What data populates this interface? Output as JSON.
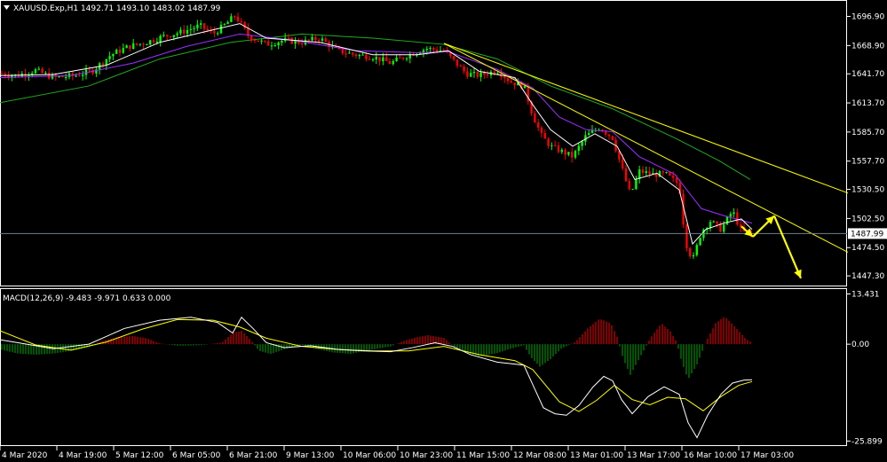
{
  "window": {
    "title": "XAUUSD.Exp,H1  1492.71 1493.10 1483.02 1487.99",
    "menu_icon": "triangle-down-icon"
  },
  "colors": {
    "background": "#000000",
    "axis": "#ffffff",
    "bull": "#00ff00",
    "bear": "#ff0000",
    "ma_fast": "#ffffff",
    "ma_purple": "#9b30ff",
    "ma_green": "#22aa22",
    "trendline": "#ffff00",
    "arrow": "#ffff00",
    "bid_line": "#708090",
    "macd_pos": "#ff0000",
    "macd_neg": "#00aa00",
    "macd_main": "#ffffff",
    "macd_signal": "#ffff00"
  },
  "chart_data": [
    {
      "type": "candlestick",
      "symbol": "XAUUSD.Exp",
      "timeframe": "H1",
      "ohlc_header": {
        "open": 1492.71,
        "high": 1493.1,
        "low": 1483.02,
        "close": 1487.99
      },
      "current_price_label": "1487.99",
      "ylim": [
        1438,
        1711
      ],
      "y_ticks": [
        "1696.90",
        "1668.90",
        "1641.70",
        "1613.70",
        "1585.70",
        "1557.70",
        "1530.50",
        "1502.50",
        "1474.50",
        "1447.30"
      ],
      "y_tick_values": [
        1696.9,
        1668.9,
        1641.7,
        1613.7,
        1585.7,
        1557.7,
        1530.5,
        1502.5,
        1474.5,
        1447.3
      ],
      "x_ticks": [
        "4 Mar 2020",
        "4 Mar 19:00",
        "5 Mar 12:00",
        "6 Mar 05:00",
        "6 Mar 21:00",
        "9 Mar 13:00",
        "10 Mar 06:00",
        "10 Mar 23:00",
        "11 Mar 15:00",
        "12 Mar 08:00",
        "13 Mar 01:00",
        "13 Mar 17:00",
        "16 Mar 10:00",
        "17 Mar 03:00"
      ],
      "price_path": [
        [
          0,
          1642
        ],
        [
          18,
          1640
        ],
        [
          40,
          1645
        ],
        [
          60,
          1638
        ],
        [
          85,
          1640
        ],
        [
          105,
          1645
        ],
        [
          125,
          1660
        ],
        [
          145,
          1668
        ],
        [
          165,
          1672
        ],
        [
          185,
          1678
        ],
        [
          205,
          1682
        ],
        [
          225,
          1688
        ],
        [
          240,
          1680
        ],
        [
          255,
          1690
        ],
        [
          265,
          1698
        ],
        [
          280,
          1678
        ],
        [
          300,
          1670
        ],
        [
          320,
          1674
        ],
        [
          340,
          1672
        ],
        [
          360,
          1676
        ],
        [
          380,
          1664
        ],
        [
          400,
          1660
        ],
        [
          420,
          1658
        ],
        [
          440,
          1652
        ],
        [
          460,
          1660
        ],
        [
          480,
          1666
        ],
        [
          500,
          1664
        ],
        [
          510,
          1655
        ],
        [
          525,
          1642
        ],
        [
          540,
          1640
        ],
        [
          560,
          1645
        ],
        [
          575,
          1634
        ],
        [
          590,
          1630
        ],
        [
          600,
          1602
        ],
        [
          610,
          1582
        ],
        [
          620,
          1572
        ],
        [
          630,
          1568
        ],
        [
          645,
          1562
        ],
        [
          660,
          1582
        ],
        [
          675,
          1590
        ],
        [
          690,
          1580
        ],
        [
          700,
          1552
        ],
        [
          710,
          1525
        ],
        [
          720,
          1548
        ],
        [
          735,
          1545
        ],
        [
          750,
          1545
        ],
        [
          765,
          1535
        ],
        [
          772,
          1480
        ],
        [
          780,
          1462
        ],
        [
          790,
          1490
        ],
        [
          800,
          1500
        ],
        [
          812,
          1492
        ],
        [
          825,
          1510
        ],
        [
          835,
          1490
        ],
        [
          847,
          1488
        ]
      ],
      "ma_fast_path": [
        [
          0,
          1640
        ],
        [
          60,
          1641
        ],
        [
          120,
          1650
        ],
        [
          180,
          1672
        ],
        [
          240,
          1684
        ],
        [
          270,
          1690
        ],
        [
          300,
          1676
        ],
        [
          360,
          1672
        ],
        [
          420,
          1660
        ],
        [
          470,
          1660
        ],
        [
          505,
          1664
        ],
        [
          540,
          1644
        ],
        [
          580,
          1638
        ],
        [
          600,
          1612
        ],
        [
          620,
          1588
        ],
        [
          645,
          1572
        ],
        [
          670,
          1584
        ],
        [
          695,
          1572
        ],
        [
          715,
          1540
        ],
        [
          740,
          1546
        ],
        [
          765,
          1530
        ],
        [
          780,
          1478
        ],
        [
          795,
          1492
        ],
        [
          815,
          1498
        ],
        [
          835,
          1502
        ],
        [
          847,
          1492
        ]
      ],
      "ma_purple_path": [
        [
          0,
          1638
        ],
        [
          80,
          1640
        ],
        [
          150,
          1652
        ],
        [
          210,
          1668
        ],
        [
          270,
          1680
        ],
        [
          330,
          1674
        ],
        [
          400,
          1664
        ],
        [
          470,
          1662
        ],
        [
          505,
          1663
        ],
        [
          560,
          1646
        ],
        [
          600,
          1628
        ],
        [
          630,
          1600
        ],
        [
          660,
          1588
        ],
        [
          690,
          1586
        ],
        [
          720,
          1562
        ],
        [
          760,
          1545
        ],
        [
          790,
          1512
        ],
        [
          820,
          1504
        ],
        [
          847,
          1498
        ]
      ],
      "ma_green_path": [
        [
          0,
          1614
        ],
        [
          100,
          1630
        ],
        [
          180,
          1656
        ],
        [
          260,
          1672
        ],
        [
          340,
          1680
        ],
        [
          420,
          1676
        ],
        [
          500,
          1670
        ],
        [
          560,
          1656
        ],
        [
          620,
          1630
        ],
        [
          690,
          1608
        ],
        [
          760,
          1580
        ],
        [
          810,
          1558
        ],
        [
          845,
          1540
        ]
      ],
      "trendlines": [
        {
          "x1": 500,
          "y1": 1671,
          "x2": 955,
          "y2": 1527
        },
        {
          "x1": 500,
          "y1": 1671,
          "x2": 955,
          "y2": 1470
        }
      ],
      "bid_line": 1487.99,
      "forecast_arrows": [
        {
          "x1": 835,
          "y1": 1495,
          "x2": 848,
          "y2": 1485
        },
        {
          "x1": 848,
          "y1": 1485,
          "x2": 872,
          "y2": 1505
        },
        {
          "x1": 872,
          "y1": 1505,
          "x2": 902,
          "y2": 1445
        }
      ]
    },
    {
      "type": "bar",
      "name": "MACD",
      "label": "MACD(12,26,9) -9.483 -9.971 0.633 0.000",
      "params": [
        12,
        26,
        9
      ],
      "values_shown": [
        -9.483,
        -9.971,
        0.633,
        0.0
      ],
      "ylim": [
        -27.0,
        14.5
      ],
      "y_ticks": [
        "13.431",
        "0.00",
        "-25.899"
      ],
      "y_tick_values": [
        13.431,
        0.0,
        -25.899
      ],
      "histogram": [
        [
          2,
          -1.5
        ],
        [
          20,
          -2.5
        ],
        [
          40,
          -2.8
        ],
        [
          60,
          -2.5
        ],
        [
          80,
          -1.8
        ],
        [
          100,
          -0.8
        ],
        [
          115,
          0.8
        ],
        [
          130,
          1.8
        ],
        [
          150,
          2.2
        ],
        [
          165,
          1.6
        ],
        [
          180,
          0.2
        ],
        [
          200,
          -0.4
        ],
        [
          225,
          -0.3
        ],
        [
          250,
          0.4
        ],
        [
          262,
          3.0
        ],
        [
          272,
          3.6
        ],
        [
          282,
          1.2
        ],
        [
          292,
          -1.8
        ],
        [
          305,
          -2.6
        ],
        [
          320,
          -1.4
        ],
        [
          340,
          -0.2
        ],
        [
          355,
          -1.2
        ],
        [
          375,
          -2.2
        ],
        [
          395,
          -2.6
        ],
        [
          420,
          -1.4
        ],
        [
          440,
          -0.6
        ],
        [
          455,
          0.9
        ],
        [
          468,
          1.8
        ],
        [
          482,
          2.4
        ],
        [
          500,
          1.7
        ],
        [
          512,
          -0.8
        ],
        [
          525,
          -2.2
        ],
        [
          540,
          -3.2
        ],
        [
          560,
          -2.4
        ],
        [
          575,
          -1.2
        ],
        [
          590,
          -0.3
        ],
        [
          598,
          -3.5
        ],
        [
          608,
          -6.0
        ],
        [
          620,
          -4.0
        ],
        [
          632,
          -1.2
        ],
        [
          648,
          0.6
        ],
        [
          662,
          4.2
        ],
        [
          675,
          6.8
        ],
        [
          688,
          5.6
        ],
        [
          695,
          2.0
        ],
        [
          702,
          -4.0
        ],
        [
          710,
          -8.2
        ],
        [
          720,
          -3.8
        ],
        [
          733,
          1.8
        ],
        [
          745,
          5.6
        ],
        [
          755,
          3.4
        ],
        [
          762,
          0.6
        ],
        [
          768,
          -4.8
        ],
        [
          775,
          -9.4
        ],
        [
          785,
          -5.4
        ],
        [
          795,
          0.6
        ],
        [
          806,
          5.6
        ],
        [
          816,
          7.4
        ],
        [
          828,
          4.6
        ],
        [
          840,
          1.4
        ],
        [
          847,
          0.4
        ]
      ],
      "main_path": [
        [
          0,
          1.2
        ],
        [
          30,
          0.0
        ],
        [
          60,
          -1.2
        ],
        [
          100,
          0.0
        ],
        [
          140,
          4.2
        ],
        [
          180,
          6.4
        ],
        [
          215,
          7.2
        ],
        [
          245,
          5.8
        ],
        [
          262,
          3.0
        ],
        [
          272,
          7.2
        ],
        [
          285,
          4.2
        ],
        [
          300,
          0.4
        ],
        [
          320,
          -0.9
        ],
        [
          350,
          -0.4
        ],
        [
          380,
          -1.4
        ],
        [
          410,
          -1.8
        ],
        [
          440,
          -2.0
        ],
        [
          465,
          -0.9
        ],
        [
          490,
          0.4
        ],
        [
          510,
          -0.6
        ],
        [
          530,
          -2.8
        ],
        [
          560,
          -4.8
        ],
        [
          590,
          -5.6
        ],
        [
          600,
          -10.8
        ],
        [
          612,
          -17.0
        ],
        [
          625,
          -18.6
        ],
        [
          638,
          -19.0
        ],
        [
          652,
          -16.4
        ],
        [
          668,
          -11.4
        ],
        [
          680,
          -8.6
        ],
        [
          690,
          -9.8
        ],
        [
          700,
          -14.8
        ],
        [
          712,
          -18.6
        ],
        [
          730,
          -14.0
        ],
        [
          748,
          -11.4
        ],
        [
          765,
          -13.4
        ],
        [
          775,
          -21.0
        ],
        [
          785,
          -25.0
        ],
        [
          797,
          -19.0
        ],
        [
          812,
          -13.4
        ],
        [
          825,
          -10.4
        ],
        [
          838,
          -9.6
        ],
        [
          847,
          -9.5
        ]
      ],
      "signal_path": [
        [
          0,
          3.6
        ],
        [
          40,
          -0.2
        ],
        [
          80,
          -1.6
        ],
        [
          120,
          0.6
        ],
        [
          160,
          4.0
        ],
        [
          200,
          6.6
        ],
        [
          240,
          6.4
        ],
        [
          270,
          4.6
        ],
        [
          300,
          1.6
        ],
        [
          340,
          -0.6
        ],
        [
          380,
          -1.4
        ],
        [
          420,
          -1.8
        ],
        [
          460,
          -1.8
        ],
        [
          500,
          -0.6
        ],
        [
          540,
          -2.8
        ],
        [
          580,
          -4.4
        ],
        [
          600,
          -6.8
        ],
        [
          630,
          -15.4
        ],
        [
          652,
          -18.0
        ],
        [
          672,
          -15.0
        ],
        [
          692,
          -11.0
        ],
        [
          712,
          -14.8
        ],
        [
          732,
          -16.2
        ],
        [
          752,
          -14.2
        ],
        [
          772,
          -14.6
        ],
        [
          792,
          -17.8
        ],
        [
          812,
          -14.0
        ],
        [
          832,
          -11.0
        ],
        [
          847,
          -10.0
        ]
      ]
    }
  ]
}
